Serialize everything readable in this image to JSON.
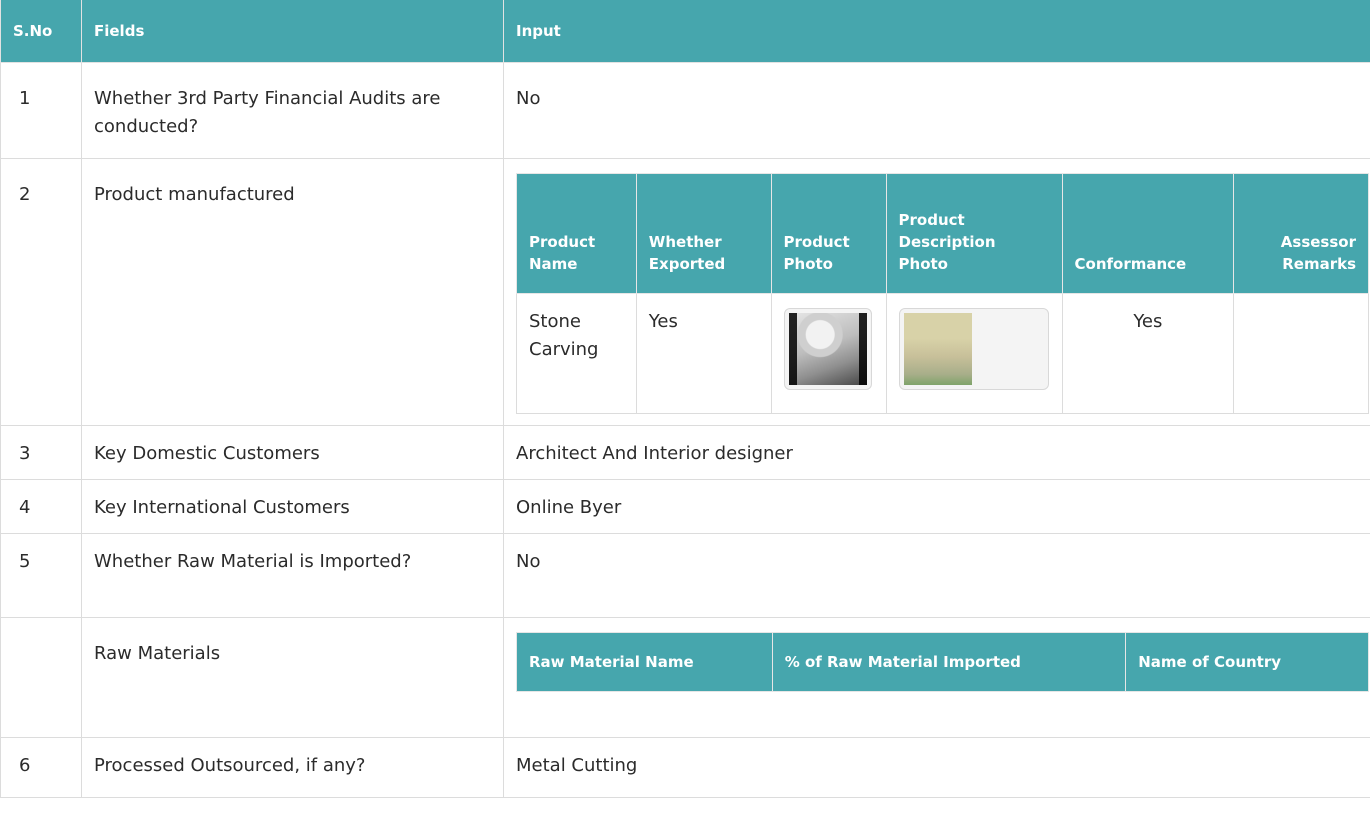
{
  "headers": {
    "sno": "S.No",
    "fields": "Fields",
    "input": "Input"
  },
  "rows": [
    {
      "sno": "1",
      "field": "Whether 3rd Party Financial Audits are conducted?",
      "input": "No"
    },
    {
      "sno": "2",
      "field": "Product manufactured"
    },
    {
      "sno": "3",
      "field": "Key Domestic Customers",
      "input": "Architect And Interior designer"
    },
    {
      "sno": "4",
      "field": "Key International Customers",
      "input": "Online Byer"
    },
    {
      "sno": "5",
      "field": "Whether Raw Material is Imported?",
      "input": "No"
    },
    {
      "sno": "",
      "field": "Raw Materials"
    },
    {
      "sno": "6",
      "field": "Processed Outsourced, if any?",
      "input": "Metal Cutting"
    }
  ],
  "products": {
    "headers": [
      "Product Name",
      "Whether Exported",
      "Product Photo",
      "Product Description Photo",
      "Conformance",
      "Assessor Remarks"
    ],
    "rows": [
      {
        "name": "Stone Carving",
        "exported": "Yes",
        "photo_icon": "stone-carving-photo",
        "desc_photo_icon": "product-description-photo",
        "conformance": "Yes",
        "remarks": ""
      }
    ]
  },
  "raw_materials": {
    "headers": [
      "Raw Material Name",
      "% of Raw Material Imported",
      "Name of Country"
    ]
  }
}
